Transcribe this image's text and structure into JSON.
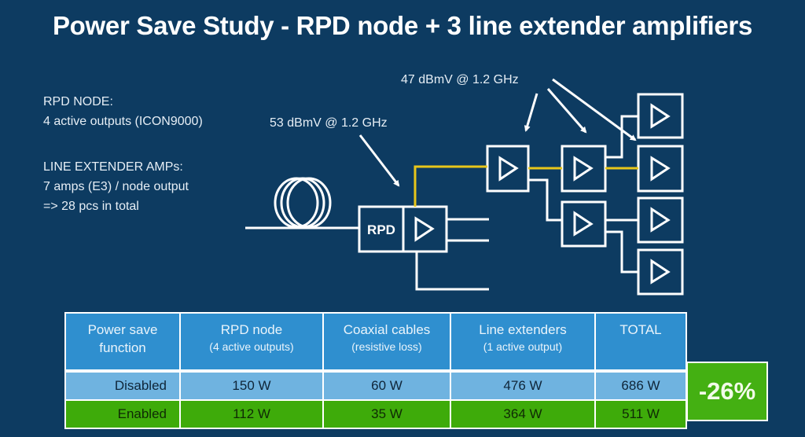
{
  "title": "Power Save Study - RPD node + 3 line extender amplifiers",
  "notes": {
    "rpd_heading": "RPD NODE:",
    "rpd_detail": "4 active outputs (ICON9000)",
    "le_heading": "LINE EXTENDER AMPs:",
    "le_detail1": "7 amps (E3) / node output",
    "le_detail2": "=> 28 pcs in total"
  },
  "diagram": {
    "label_node_level": "53 dBmV @ 1.2 GHz",
    "label_amp_level": "47 dBmV @ 1.2 GHz",
    "rpd_box_label": "RPD",
    "colors": {
      "line": "#ffffff",
      "active_path": "#e8c61a",
      "background": "#0d3b61"
    }
  },
  "table": {
    "headers": [
      {
        "main": "Power save",
        "sub": "function"
      },
      {
        "main": "RPD node",
        "sub": "(4 active outputs)"
      },
      {
        "main": "Coaxial cables",
        "sub": "(resistive loss)"
      },
      {
        "main": "Line extenders",
        "sub": "(1 active output)"
      },
      {
        "main": "TOTAL",
        "sub": ""
      }
    ],
    "rows": [
      {
        "label": "Disabled",
        "cells": [
          "150 W",
          "60 W",
          "476 W",
          "686 W"
        ]
      },
      {
        "label": "Enabled",
        "cells": [
          "112 W",
          "35 W",
          "364 W",
          "511 W"
        ]
      }
    ],
    "saving": "-26%",
    "colors": {
      "header": "#2f8fcf",
      "disabled": "#6fb3e0",
      "enabled": "#3eab0a"
    }
  }
}
